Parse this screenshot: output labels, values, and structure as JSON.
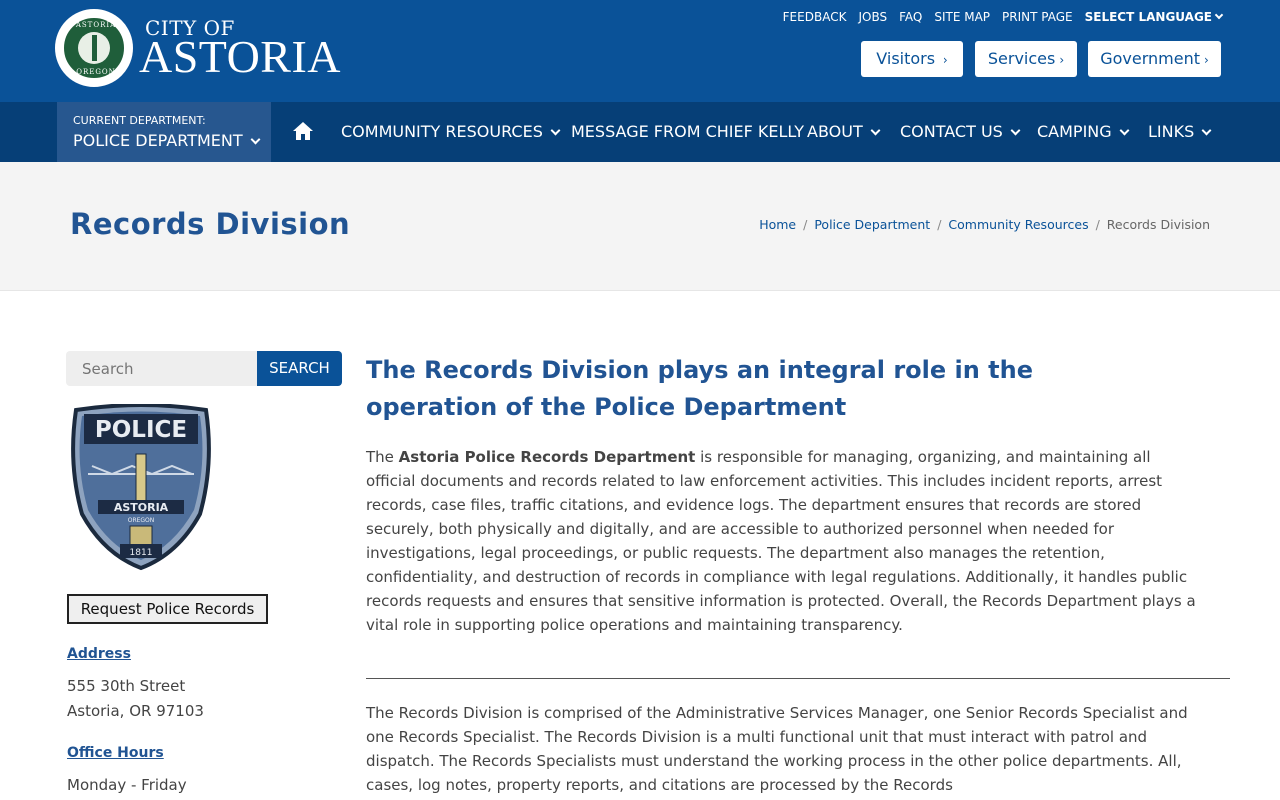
{
  "header": {
    "logo_city": "CITY OF",
    "logo_name": "ASTORIA",
    "seal_top": "ASTORIA",
    "seal_bottom": "OREGON",
    "utility": [
      "FEEDBACK",
      "JOBS",
      "FAQ",
      "SITE MAP",
      "PRINT PAGE",
      "SELECT LANGUAGE"
    ],
    "pills": [
      "Visitors",
      "Services",
      "Government"
    ]
  },
  "nav": {
    "dept_label": "CURRENT DEPARTMENT:",
    "dept_value": "POLICE DEPARTMENT",
    "items": [
      "COMMUNITY RESOURCES",
      "MESSAGE FROM CHIEF KELLY",
      "ABOUT",
      "CONTACT US",
      "CAMPING",
      "LINKS"
    ]
  },
  "page": {
    "title": "Records Division",
    "breadcrumbs": [
      "Home",
      "Police Department",
      "Community Resources",
      "Records Division"
    ]
  },
  "sidebar": {
    "search_placeholder": "Search",
    "search_button": "SEARCH",
    "badge_top": "POLICE",
    "badge_mid": "ASTORIA",
    "badge_small": "OREGON",
    "badge_year": "1811",
    "request_button": "Request Police Records",
    "address_heading": "Address",
    "address_line1": "555 30th Street",
    "address_line2": "Astoria, OR 97103",
    "hours_heading": "Office Hours",
    "hours_line1": "Monday - Friday"
  },
  "main": {
    "heading": "The Records Division plays an integral role in the operation of the Police Department",
    "p1_start": "The ",
    "p1_bold": "Astoria Police Records Department",
    "p1_rest": " is responsible for managing, organizing, and maintaining all official documents and records related to law enforcement activities. This includes incident reports, arrest records, case files, traffic citations, and evidence logs. The department ensures that records are stored securely, both physically and digitally, and are accessible to authorized personnel when needed for investigations, legal proceedings, or public requests. The department also manages the retention, confidentiality, and destruction of records in compliance with legal regulations. Additionally, it handles public records requests and ensures that sensitive information is protected. Overall, the Records Department plays a vital role in supporting police operations and maintaining transparency.",
    "p2": "The Records Division is comprised of the Administrative Services Manager, one Senior Records Specialist and one Records Specialist. The Records Division is a multi functional unit that must interact with patrol and dispatch. The Records Specialists must understand the working process in the other police departments. All, cases, log notes, property reports, and citations are processed by the Records"
  },
  "colors": {
    "header_blue": "#0a5298",
    "nav_blue": "#063f77",
    "dept_blue": "#27578f",
    "heading_blue": "#215493"
  }
}
